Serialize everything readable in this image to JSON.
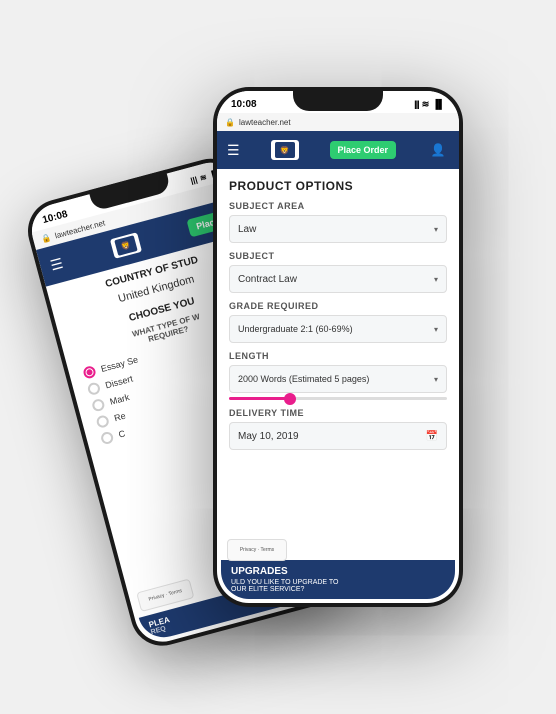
{
  "back_phone": {
    "status": {
      "time": "10:08",
      "url": "lawteacher.net"
    },
    "nav": {
      "place_order": "Place O",
      "logo_alt": "LawTeacher"
    },
    "content": {
      "country_title": "COUNTRY OF STUD",
      "country_value": "United Kingdom",
      "choose_title": "CHOOSE YOU",
      "what_type_label": "WHAT TYPE OF W",
      "require_label": "REQUIRE?",
      "radio_items": [
        {
          "label": "Essay Se",
          "selected": true
        },
        {
          "label": "Dissert",
          "selected": false
        },
        {
          "label": "Mark",
          "selected": false
        },
        {
          "label": "Re",
          "selected": false
        },
        {
          "label": "C",
          "selected": false
        }
      ],
      "please_bar": "PLEA",
      "req_bar": "REQ"
    }
  },
  "front_phone": {
    "status": {
      "time": "10:08",
      "url": "lawteacher.net",
      "signal": "▌▌▌",
      "wifi": "WiFi",
      "battery": "🔋"
    },
    "nav": {
      "place_order": "Place Order",
      "logo_alt": "LawTeacher"
    },
    "content": {
      "page_title": "PRODUCT OPTIONS",
      "subject_area_label": "SUBJECT AREA",
      "subject_area_value": "Law",
      "subject_label": "SUBJECT",
      "subject_value": "Contract Law",
      "grade_label": "GRADE REQUIRED",
      "grade_value": "Undergraduate 2:1 (60-69%)",
      "length_label": "LENGTH",
      "length_value": "2000 Words (Estimated 5 pages)",
      "delivery_label": "DELIVERY TIME",
      "delivery_value": "May 10, 2019",
      "upgrades_title": "UPGRADES",
      "upgrades_question": "ULD YOU LIKE TO UPGRADE TO",
      "upgrades_sub": "OUR ELITE SERVICE?"
    }
  },
  "icons": {
    "chevron": "▾",
    "calendar": "📅",
    "lock": "🔒",
    "hamburger": "☰",
    "user": "👤",
    "signal": "|||",
    "wifi": "≋",
    "battery": "▐"
  }
}
